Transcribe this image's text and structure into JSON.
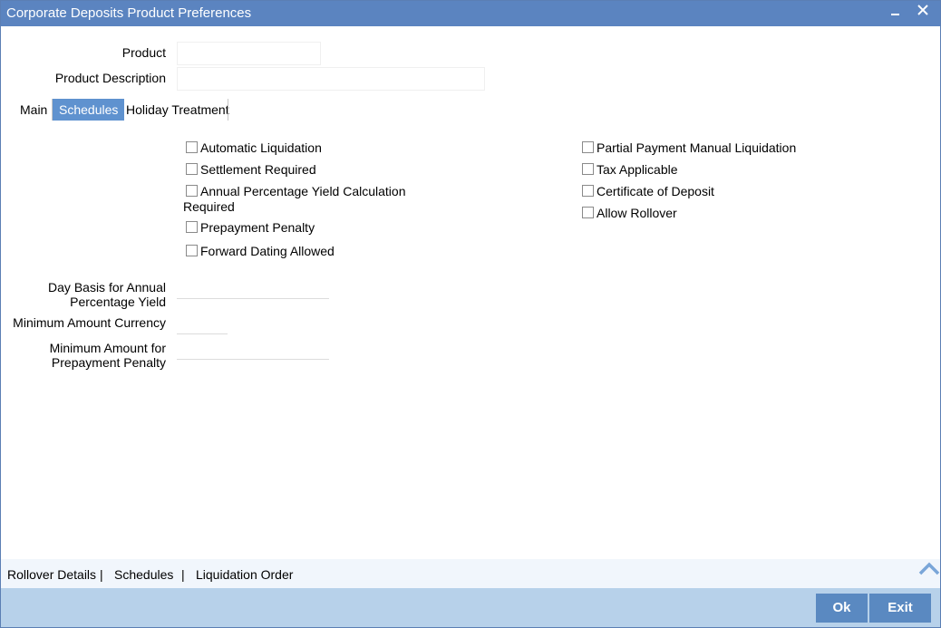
{
  "window": {
    "title": "Corporate Deposits Product Preferences"
  },
  "header": {
    "product_label": "Product",
    "product_value": "",
    "description_label": "Product Description",
    "description_value": ""
  },
  "tabs": [
    {
      "label": "Main",
      "active": false
    },
    {
      "label": "Schedules",
      "active": true
    },
    {
      "label": "Holiday Treatment",
      "active": false
    }
  ],
  "checkboxes_left": [
    {
      "label": "Automatic Liquidation",
      "checked": false
    },
    {
      "label": "Settlement Required",
      "checked": false
    },
    {
      "label": "Annual Percentage Yield Calculation",
      "label2": "Required",
      "checked": false
    },
    {
      "label": "Prepayment Penalty",
      "checked": false
    },
    {
      "label": "Forward Dating Allowed",
      "checked": false
    }
  ],
  "checkboxes_right": [
    {
      "label": "Partial Payment Manual Liquidation",
      "checked": false
    },
    {
      "label": "Tax Applicable",
      "checked": false
    },
    {
      "label": "Certificate of Deposit",
      "checked": false
    },
    {
      "label": "Allow Rollover",
      "checked": false
    }
  ],
  "fields": {
    "day_basis_label_1": "Day Basis for Annual",
    "day_basis_label_2": "Percentage Yield",
    "day_basis_value": "",
    "min_amount_currency_label": "Minimum Amount Currency",
    "min_amount_currency_value": "",
    "min_amount_label_1": "Minimum Amount for",
    "min_amount_label_2": "Prepayment Penalty",
    "min_amount_value": ""
  },
  "footer": {
    "links": [
      "Rollover Details",
      "Schedules",
      "Liquidation Order"
    ],
    "separator": "|",
    "ok_label": "Ok",
    "exit_label": "Exit"
  },
  "icons": {
    "minimize": "minimize-icon",
    "close": "close-icon",
    "scroll_up": "chevron-up-icon"
  },
  "colors": {
    "titlebar": "#5b84c0",
    "active_tab": "#5f92cf",
    "bottombar": "#b7d1ea",
    "button": "#5a89c1"
  }
}
